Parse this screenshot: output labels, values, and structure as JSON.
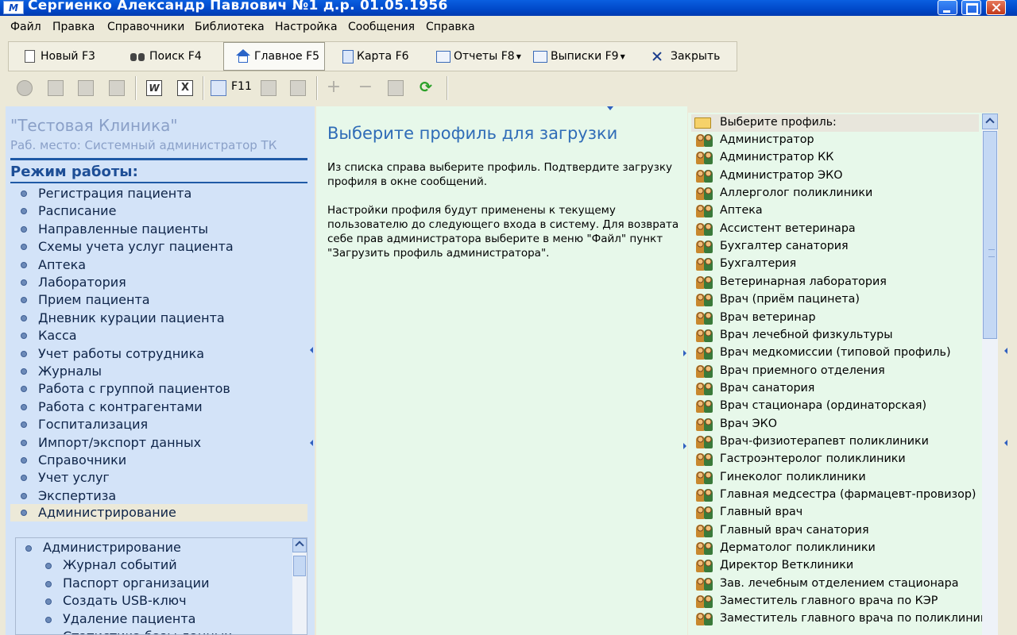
{
  "window": {
    "title": "Сергиенко Александр Павлович  №1  д.р. 01.05.1956",
    "app_icon_text": "M"
  },
  "menu": [
    "Файл",
    "Правка",
    "Справочники",
    "Библиотека",
    "Настройка",
    "Сообщения",
    "Справка"
  ],
  "toolbar": {
    "new": "Новый F3",
    "search": "Поиск F4",
    "main": "Главное F5",
    "card": "Карта F6",
    "reports": "Отчеты F8",
    "extracts": "Выписки F9",
    "close": "Закрыть"
  },
  "small_toolbar": {
    "word": "W",
    "excel": "X",
    "f11": "F11"
  },
  "left": {
    "clinic": "\"Тестовая Клиника\"",
    "workplace": "Раб. место: Системный администратор ТК",
    "mode_header": "Режим работы:",
    "items": [
      "Регистрация пациента",
      "Расписание",
      "Направленные пациенты",
      "Схемы учета услуг пациента",
      "Аптека",
      "Лаборатория",
      "Прием пациента",
      "Дневник курации пациента",
      "Касса",
      "Учет работы сотрудника",
      "Журналы",
      "Работа с группой пациентов",
      "Работа с контрагентами",
      "Госпитализация",
      "Импорт/экспорт данных",
      "Справочники",
      "Учет услуг",
      "Экспертиза",
      "Администрирование"
    ],
    "sub_header": "Администрирование",
    "sub_items": [
      "Журнал событий",
      "Паспорт организации",
      "Создать USB-ключ",
      "Удаление пациента",
      "Статистика базы данных"
    ]
  },
  "center": {
    "title": "Выберите профиль для загрузки",
    "p1": "Из списка справа выберите профиль. Подтвердите загрузку профиля в окне сообщений.",
    "p2": "Настройки профиля будут применены к текущему пользователю до следующего входа в систему. Для возврата себе прав администратора выберите в меню \"Файл\" пункт \"Загрузить профиль администратора\"."
  },
  "profiles": {
    "header": "Выберите профиль:",
    "items": [
      "Администратор",
      "Администратор КК",
      "Администратор ЭКО",
      "Аллерголог поликлиники",
      "Аптека",
      "Ассистент ветеринара",
      "Бухгалтер санатория",
      "Бухгалтерия",
      "Ветеринарная лаборатория",
      "Врач (приём пацинета)",
      "Врач ветеринар",
      "Врач лечебной физкультуры",
      "Врач медкомиссии (типовой профиль)",
      "Врач приемного отделения",
      "Врач санатория",
      "Врач стационара (ординаторская)",
      "Врач ЭКО",
      "Врач-физиотерапевт поликлиники",
      "Гастроэнтеролог поликлиники",
      "Гинеколог поликлиники",
      "Главная медсестра (фармацевт-провизор)",
      "Главный врач",
      "Главный врач санатория",
      "Дерматолог поликлиники",
      "Директор Ветклиники",
      "Зав. лечебным отделением стационара",
      "Заместитель главного врача по КЭР",
      "Заместитель главного врача по поликлинике"
    ]
  }
}
